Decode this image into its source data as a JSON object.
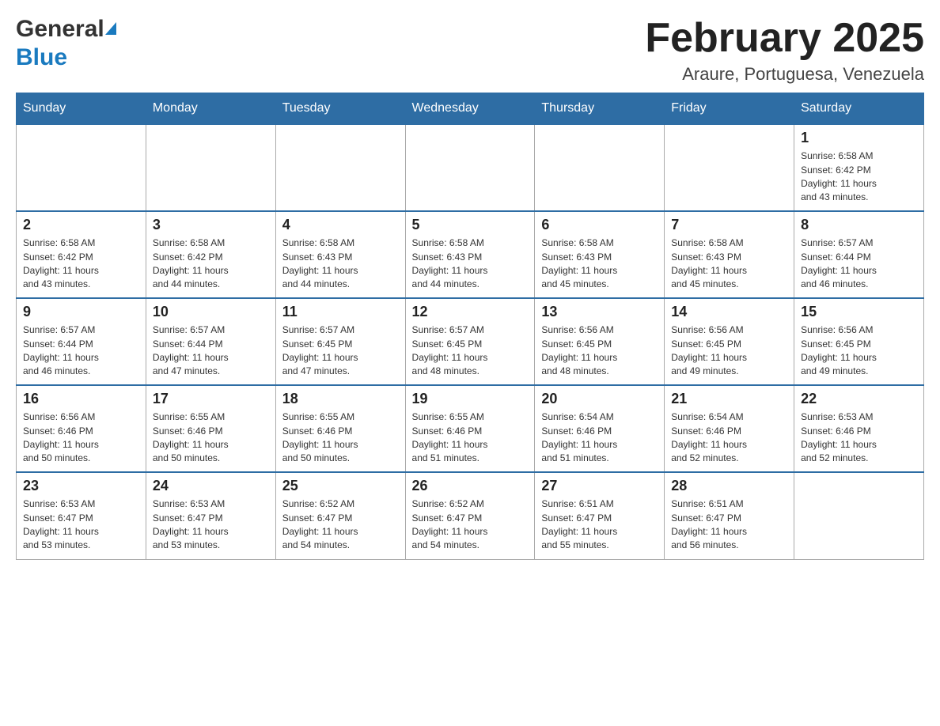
{
  "header": {
    "logo_general": "General",
    "logo_blue": "Blue",
    "month_title": "February 2025",
    "location": "Araure, Portuguesa, Venezuela"
  },
  "calendar": {
    "days_of_week": [
      "Sunday",
      "Monday",
      "Tuesday",
      "Wednesday",
      "Thursday",
      "Friday",
      "Saturday"
    ],
    "weeks": [
      [
        {
          "day": "",
          "info": ""
        },
        {
          "day": "",
          "info": ""
        },
        {
          "day": "",
          "info": ""
        },
        {
          "day": "",
          "info": ""
        },
        {
          "day": "",
          "info": ""
        },
        {
          "day": "",
          "info": ""
        },
        {
          "day": "1",
          "info": "Sunrise: 6:58 AM\nSunset: 6:42 PM\nDaylight: 11 hours\nand 43 minutes."
        }
      ],
      [
        {
          "day": "2",
          "info": "Sunrise: 6:58 AM\nSunset: 6:42 PM\nDaylight: 11 hours\nand 43 minutes."
        },
        {
          "day": "3",
          "info": "Sunrise: 6:58 AM\nSunset: 6:42 PM\nDaylight: 11 hours\nand 44 minutes."
        },
        {
          "day": "4",
          "info": "Sunrise: 6:58 AM\nSunset: 6:43 PM\nDaylight: 11 hours\nand 44 minutes."
        },
        {
          "day": "5",
          "info": "Sunrise: 6:58 AM\nSunset: 6:43 PM\nDaylight: 11 hours\nand 44 minutes."
        },
        {
          "day": "6",
          "info": "Sunrise: 6:58 AM\nSunset: 6:43 PM\nDaylight: 11 hours\nand 45 minutes."
        },
        {
          "day": "7",
          "info": "Sunrise: 6:58 AM\nSunset: 6:43 PM\nDaylight: 11 hours\nand 45 minutes."
        },
        {
          "day": "8",
          "info": "Sunrise: 6:57 AM\nSunset: 6:44 PM\nDaylight: 11 hours\nand 46 minutes."
        }
      ],
      [
        {
          "day": "9",
          "info": "Sunrise: 6:57 AM\nSunset: 6:44 PM\nDaylight: 11 hours\nand 46 minutes."
        },
        {
          "day": "10",
          "info": "Sunrise: 6:57 AM\nSunset: 6:44 PM\nDaylight: 11 hours\nand 47 minutes."
        },
        {
          "day": "11",
          "info": "Sunrise: 6:57 AM\nSunset: 6:45 PM\nDaylight: 11 hours\nand 47 minutes."
        },
        {
          "day": "12",
          "info": "Sunrise: 6:57 AM\nSunset: 6:45 PM\nDaylight: 11 hours\nand 48 minutes."
        },
        {
          "day": "13",
          "info": "Sunrise: 6:56 AM\nSunset: 6:45 PM\nDaylight: 11 hours\nand 48 minutes."
        },
        {
          "day": "14",
          "info": "Sunrise: 6:56 AM\nSunset: 6:45 PM\nDaylight: 11 hours\nand 49 minutes."
        },
        {
          "day": "15",
          "info": "Sunrise: 6:56 AM\nSunset: 6:45 PM\nDaylight: 11 hours\nand 49 minutes."
        }
      ],
      [
        {
          "day": "16",
          "info": "Sunrise: 6:56 AM\nSunset: 6:46 PM\nDaylight: 11 hours\nand 50 minutes."
        },
        {
          "day": "17",
          "info": "Sunrise: 6:55 AM\nSunset: 6:46 PM\nDaylight: 11 hours\nand 50 minutes."
        },
        {
          "day": "18",
          "info": "Sunrise: 6:55 AM\nSunset: 6:46 PM\nDaylight: 11 hours\nand 50 minutes."
        },
        {
          "day": "19",
          "info": "Sunrise: 6:55 AM\nSunset: 6:46 PM\nDaylight: 11 hours\nand 51 minutes."
        },
        {
          "day": "20",
          "info": "Sunrise: 6:54 AM\nSunset: 6:46 PM\nDaylight: 11 hours\nand 51 minutes."
        },
        {
          "day": "21",
          "info": "Sunrise: 6:54 AM\nSunset: 6:46 PM\nDaylight: 11 hours\nand 52 minutes."
        },
        {
          "day": "22",
          "info": "Sunrise: 6:53 AM\nSunset: 6:46 PM\nDaylight: 11 hours\nand 52 minutes."
        }
      ],
      [
        {
          "day": "23",
          "info": "Sunrise: 6:53 AM\nSunset: 6:47 PM\nDaylight: 11 hours\nand 53 minutes."
        },
        {
          "day": "24",
          "info": "Sunrise: 6:53 AM\nSunset: 6:47 PM\nDaylight: 11 hours\nand 53 minutes."
        },
        {
          "day": "25",
          "info": "Sunrise: 6:52 AM\nSunset: 6:47 PM\nDaylight: 11 hours\nand 54 minutes."
        },
        {
          "day": "26",
          "info": "Sunrise: 6:52 AM\nSunset: 6:47 PM\nDaylight: 11 hours\nand 54 minutes."
        },
        {
          "day": "27",
          "info": "Sunrise: 6:51 AM\nSunset: 6:47 PM\nDaylight: 11 hours\nand 55 minutes."
        },
        {
          "day": "28",
          "info": "Sunrise: 6:51 AM\nSunset: 6:47 PM\nDaylight: 11 hours\nand 56 minutes."
        },
        {
          "day": "",
          "info": ""
        }
      ]
    ]
  }
}
